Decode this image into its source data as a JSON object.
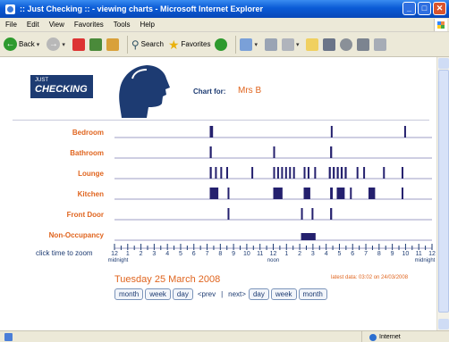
{
  "window": {
    "title": ":: Just Checking :: - viewing charts - Microsoft Internet Explorer",
    "menu": [
      "File",
      "Edit",
      "View",
      "Favorites",
      "Tools",
      "Help"
    ],
    "toolbar": {
      "back": "Back",
      "search": "Search",
      "favorites": "Favorites"
    }
  },
  "page": {
    "logo_line1": "JUST",
    "logo_line2": "CHECKING",
    "chart_for_label": "Chart for:",
    "person": "Mrs B",
    "zoom_hint": "click time to zoom",
    "date": "Tuesday 25 March 2008",
    "latest": "latest data: 03:02 on 24/03/2008",
    "nav": {
      "month1": "month",
      "week1": "week",
      "day1": "day",
      "prev": "<prev",
      "divider": "|",
      "next": "next>",
      "day2": "day",
      "week2": "week",
      "month2": "month"
    }
  },
  "statusbar": {
    "zone": "Internet"
  },
  "colors": {
    "accent": "#e0651f",
    "navy": "#1d3b72",
    "bar": "#24206e",
    "rule": "#9c9ec4"
  },
  "chart_data": {
    "type": "timeline",
    "x_unit": "hour of day (0 = midnight, 24 = midnight)",
    "xlim": [
      0,
      24
    ],
    "tick_labels": [
      "12",
      "1",
      "2",
      "3",
      "4",
      "5",
      "6",
      "7",
      "8",
      "9",
      "10",
      "11",
      "12",
      "1",
      "2",
      "3",
      "4",
      "5",
      "6",
      "7",
      "8",
      "9",
      "10",
      "11",
      "12"
    ],
    "tick_sublabels": {
      "0": "midnight",
      "12": "noon",
      "24": "midnight"
    },
    "rows": [
      {
        "name": "Bedroom",
        "events": [
          [
            7.2,
            7.45
          ],
          [
            16.35,
            16.45
          ],
          [
            21.9,
            22.0
          ]
        ]
      },
      {
        "name": "Bathroom",
        "events": [
          [
            7.2,
            7.35
          ],
          [
            12.0,
            12.1
          ],
          [
            16.3,
            16.45
          ]
        ]
      },
      {
        "name": "Lounge",
        "events": [
          [
            7.2,
            7.35
          ],
          [
            7.6,
            7.7
          ],
          [
            8.0,
            8.1
          ],
          [
            8.45,
            8.55
          ],
          [
            10.35,
            10.45
          ],
          [
            12.0,
            12.1
          ],
          [
            12.3,
            12.4
          ],
          [
            12.6,
            12.7
          ],
          [
            12.9,
            13.0
          ],
          [
            13.2,
            13.3
          ],
          [
            13.5,
            13.6
          ],
          [
            14.3,
            14.4
          ],
          [
            14.6,
            14.7
          ],
          [
            15.1,
            15.2
          ],
          [
            16.2,
            16.35
          ],
          [
            16.5,
            16.65
          ],
          [
            16.8,
            16.95
          ],
          [
            17.1,
            17.25
          ],
          [
            17.4,
            17.55
          ],
          [
            18.3,
            18.4
          ],
          [
            18.8,
            18.9
          ],
          [
            20.3,
            20.4
          ],
          [
            21.7,
            21.8
          ]
        ]
      },
      {
        "name": "Kitchen",
        "events": [
          [
            7.2,
            7.85
          ],
          [
            8.55,
            8.65
          ],
          [
            12.0,
            12.7
          ],
          [
            14.3,
            14.8
          ],
          [
            16.3,
            16.5
          ],
          [
            16.8,
            17.4
          ],
          [
            17.8,
            17.9
          ],
          [
            19.2,
            19.7
          ],
          [
            21.7,
            21.8
          ]
        ]
      },
      {
        "name": "Front Door",
        "events": [
          [
            8.55,
            8.65
          ],
          [
            14.1,
            14.2
          ],
          [
            14.9,
            15.0
          ],
          [
            16.3,
            16.45
          ]
        ]
      },
      {
        "name": "Non-Occupancy",
        "events": [
          [
            14.1,
            15.2
          ]
        ]
      }
    ]
  }
}
